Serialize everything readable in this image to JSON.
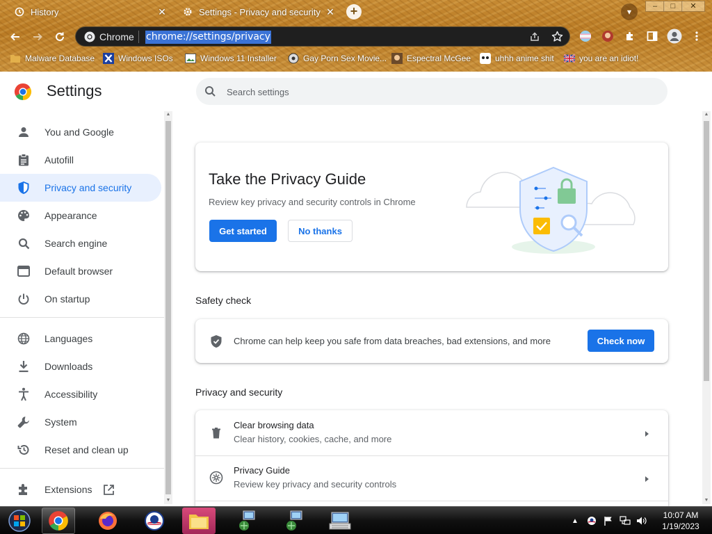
{
  "browser": {
    "tabs": [
      {
        "title": "History",
        "icon": "history-icon"
      },
      {
        "title": "Settings - Privacy and security",
        "icon": "gear-icon"
      }
    ],
    "new_tab": "+",
    "window_controls": {
      "minimize": "–",
      "maximize": "□",
      "close": "✕"
    },
    "omnibox": {
      "chip": "Chrome",
      "url": "chrome://settings/privacy"
    },
    "bookmarks": [
      {
        "label": "Malware Database",
        "icon": "folder-icon"
      },
      {
        "label": "Windows ISOs",
        "icon": "x-logo-icon"
      },
      {
        "label": "Windows 11 Installer",
        "icon": "image-icon"
      },
      {
        "label": "Gay Porn Sex Movie...",
        "icon": "favicon-icon"
      },
      {
        "label": "Espectral McGee",
        "icon": "favicon-icon"
      },
      {
        "label": "uhhh anime shit",
        "icon": "favicon-icon"
      },
      {
        "label": "you are an idiot!",
        "icon": "flag-icon"
      }
    ]
  },
  "settings": {
    "title": "Settings",
    "search_placeholder": "Search settings",
    "nav_group1": [
      {
        "label": "You and Google",
        "icon": "person-icon"
      },
      {
        "label": "Autofill",
        "icon": "clipboard-icon"
      },
      {
        "label": "Privacy and security",
        "icon": "shield-icon",
        "active": true
      },
      {
        "label": "Appearance",
        "icon": "palette-icon"
      },
      {
        "label": "Search engine",
        "icon": "search-icon"
      },
      {
        "label": "Default browser",
        "icon": "browser-icon"
      },
      {
        "label": "On startup",
        "icon": "power-icon"
      }
    ],
    "nav_group2": [
      {
        "label": "Languages",
        "icon": "globe-icon"
      },
      {
        "label": "Downloads",
        "icon": "download-icon"
      },
      {
        "label": "Accessibility",
        "icon": "accessibility-icon"
      },
      {
        "label": "System",
        "icon": "wrench-icon"
      },
      {
        "label": "Reset and clean up",
        "icon": "restore-icon"
      }
    ],
    "nav_group3": [
      {
        "label": "Extensions",
        "icon": "puzzle-icon"
      }
    ],
    "privacy_guide": {
      "title": "Take the Privacy Guide",
      "description": "Review key privacy and security controls in Chrome",
      "start_label": "Get started",
      "dismiss_label": "No thanks"
    },
    "safety_check": {
      "section_title": "Safety check",
      "text": "Chrome can help keep you safe from data breaches, bad extensions, and more",
      "button_label": "Check now"
    },
    "privacy_section": {
      "section_title": "Privacy and security",
      "rows": [
        {
          "title": "Clear browsing data",
          "subtitle": "Clear history, cookies, cache, and more",
          "icon": "trash-icon"
        },
        {
          "title": "Privacy Guide",
          "subtitle": "Review key privacy and security controls",
          "icon": "compass-icon"
        }
      ]
    }
  },
  "taskbar": {
    "clock_time": "10:07 AM",
    "clock_date": "1/19/2023"
  },
  "colors": {
    "accent": "#1a73e8",
    "active_nav_bg": "#e8f0fe",
    "omnibox_bg": "#1f1f1f",
    "url_selection": "#3b73d6"
  }
}
